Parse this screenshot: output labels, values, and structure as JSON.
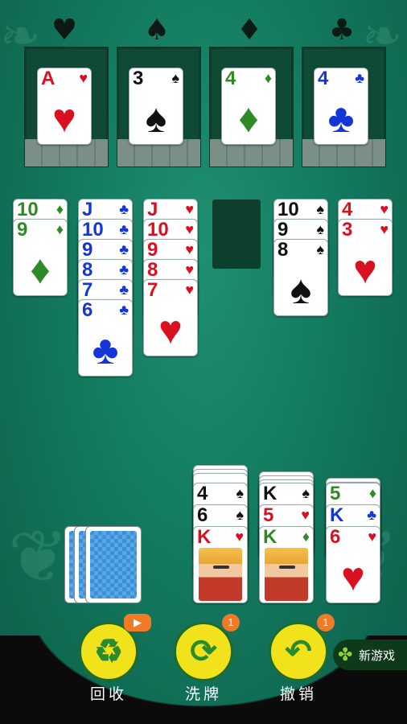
{
  "foundation_suits": [
    "♥",
    "♠",
    "♦",
    "♣"
  ],
  "foundations": [
    {
      "rank": "A",
      "suit": "♥",
      "color": "red"
    },
    {
      "rank": "3",
      "suit": "♠",
      "color": "black"
    },
    {
      "rank": "4",
      "suit": "♦",
      "color": "green"
    },
    {
      "rank": "4",
      "suit": "♣",
      "color": "blue"
    }
  ],
  "tableau": [
    {
      "cards": [
        {
          "rank": "10",
          "suit": "♦",
          "color": "green"
        },
        {
          "rank": "9",
          "suit": "♦",
          "color": "green"
        }
      ]
    },
    {
      "cards": [
        {
          "rank": "J",
          "suit": "♣",
          "color": "blue"
        },
        {
          "rank": "10",
          "suit": "♣",
          "color": "blue"
        },
        {
          "rank": "9",
          "suit": "♣",
          "color": "blue"
        },
        {
          "rank": "8",
          "suit": "♣",
          "color": "blue"
        },
        {
          "rank": "7",
          "suit": "♣",
          "color": "blue"
        },
        {
          "rank": "6",
          "suit": "♣",
          "color": "blue"
        }
      ]
    },
    {
      "cards": [
        {
          "rank": "J",
          "suit": "♥",
          "color": "red"
        },
        {
          "rank": "10",
          "suit": "♥",
          "color": "red"
        },
        {
          "rank": "9",
          "suit": "♥",
          "color": "red"
        },
        {
          "rank": "8",
          "suit": "♥",
          "color": "red"
        },
        {
          "rank": "7",
          "suit": "♥",
          "color": "red"
        }
      ]
    },
    {
      "cards": []
    },
    {
      "cards": [
        {
          "rank": "10",
          "suit": "♠",
          "color": "black"
        },
        {
          "rank": "9",
          "suit": "♠",
          "color": "black"
        },
        {
          "rank": "8",
          "suit": "♠",
          "color": "black"
        }
      ]
    },
    {
      "cards": [
        {
          "rank": "4",
          "suit": "♥",
          "color": "red"
        },
        {
          "rank": "3",
          "suit": "♥",
          "color": "red"
        }
      ]
    }
  ],
  "reserve": [
    {
      "cards": [
        {
          "rank": "4",
          "suit": "♠",
          "color": "black"
        },
        {
          "rank": "6",
          "suit": "♠",
          "color": "black"
        },
        {
          "rank": "K",
          "suit": "♥",
          "color": "red",
          "king": true
        }
      ]
    },
    {
      "cards": [
        {
          "rank": "K",
          "suit": "♠",
          "color": "black"
        },
        {
          "rank": "5",
          "suit": "♥",
          "color": "red"
        },
        {
          "rank": "K",
          "suit": "♦",
          "color": "green",
          "king": true
        }
      ]
    },
    {
      "cards": [
        {
          "rank": "5",
          "suit": "♦",
          "color": "green"
        },
        {
          "rank": "K",
          "suit": "♣",
          "color": "blue"
        },
        {
          "rank": "6",
          "suit": "♥",
          "color": "red"
        }
      ]
    }
  ],
  "buttons": {
    "recycle": {
      "label": "回收",
      "icon": "♻"
    },
    "shuffle": {
      "label": "洗牌",
      "icon": "⟳",
      "badge": "1"
    },
    "undo": {
      "label": "撤销",
      "icon": "↶",
      "badge": "1"
    }
  },
  "new_game": "新游戏"
}
